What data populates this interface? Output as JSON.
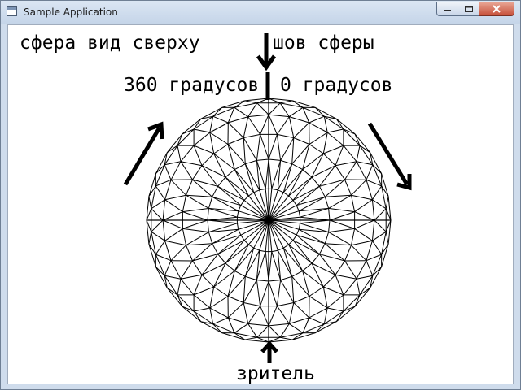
{
  "window": {
    "title": "Sample Application",
    "icon": "app-window-icon",
    "buttons": {
      "minimize": "minimize-icon",
      "maximize": "maximize-icon",
      "close": "close-icon"
    }
  },
  "labels": {
    "top_left": "сфера вид сверху",
    "seam": "шов сферы",
    "left_degrees": "360 градусов",
    "right_degrees": "0 градусов",
    "viewer": "зритель"
  },
  "sphere": {
    "rings": 6,
    "segments": 32,
    "line_color": "#000000",
    "arrow_color": "#000000"
  }
}
